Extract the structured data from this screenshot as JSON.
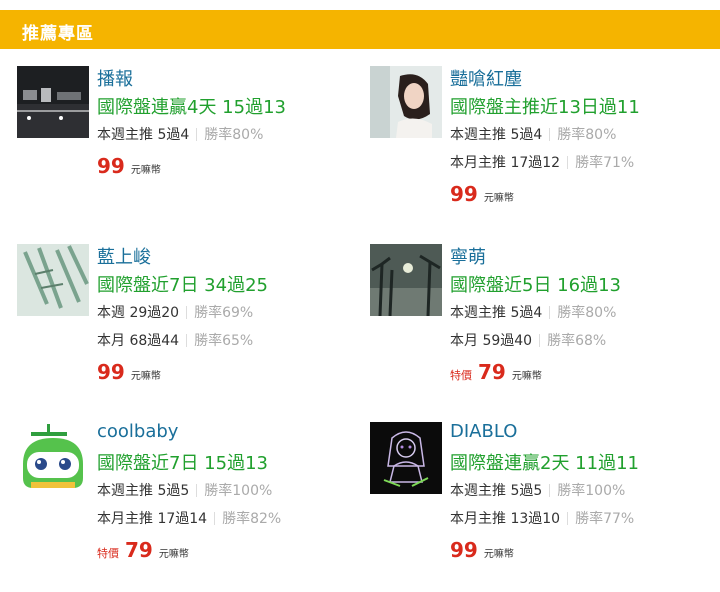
{
  "section_title": "推薦專區",
  "colors": {
    "header_bg": "#f5b400",
    "name": "#1a6f9a",
    "headline": "#21a02e",
    "price": "#d92a1c",
    "rate": "#aaaaaa"
  },
  "cards": [
    {
      "name": "播報",
      "headline": "國際盤連贏4天 15過13",
      "stats": [
        {
          "label": "本週主推 5過4",
          "rate": "勝率80%"
        }
      ],
      "price": {
        "special": "",
        "value": "99",
        "unit": "元嘛幣"
      },
      "avatar_icon": "night-street-photo"
    },
    {
      "name": "豔嗆紅塵",
      "headline": "國際盤主推近13日過11",
      "stats": [
        {
          "label": "本週主推 5過4",
          "rate": "勝率80%"
        },
        {
          "label": "本月主推 17過12",
          "rate": "勝率71%"
        }
      ],
      "price": {
        "special": "",
        "value": "99",
        "unit": "元嘛幣"
      },
      "avatar_icon": "girl-portrait-photo"
    },
    {
      "name": "藍上峻",
      "headline": "國際盤近7日 34過25",
      "stats": [
        {
          "label": "本週 29過20",
          "rate": "勝率69%"
        },
        {
          "label": "本月 68過44",
          "rate": "勝率65%"
        }
      ],
      "price": {
        "special": "",
        "value": "99",
        "unit": "元嘛幣"
      },
      "avatar_icon": "sketch-drawing"
    },
    {
      "name": "寧萌",
      "headline": "國際盤近5日 16過13",
      "stats": [
        {
          "label": "本週主推 5過4",
          "rate": "勝率80%"
        },
        {
          "label": "本月 59過40",
          "rate": "勝率68%"
        }
      ],
      "price": {
        "special": "特價",
        "value": "79",
        "unit": "元嘛幣"
      },
      "avatar_icon": "palm-trees-photo"
    },
    {
      "name": "coolbaby",
      "headline": "國際盤近7日 15過13",
      "stats": [
        {
          "label": "本週主推 5過5",
          "rate": "勝率100%"
        },
        {
          "label": "本月主推 17過14",
          "rate": "勝率82%"
        }
      ],
      "price": {
        "special": "特價",
        "value": "79",
        "unit": "元嘛幣"
      },
      "avatar_icon": "robot-car-icon"
    },
    {
      "name": "DIABLO",
      "headline": "國際盤連贏2天 11過11",
      "stats": [
        {
          "label": "本週主推 5過5",
          "rate": "勝率100%"
        },
        {
          "label": "本月主推 13過10",
          "rate": "勝率77%"
        }
      ],
      "price": {
        "special": "",
        "value": "99",
        "unit": "元嘛幣"
      },
      "avatar_icon": "anime-girl-drawing"
    }
  ]
}
